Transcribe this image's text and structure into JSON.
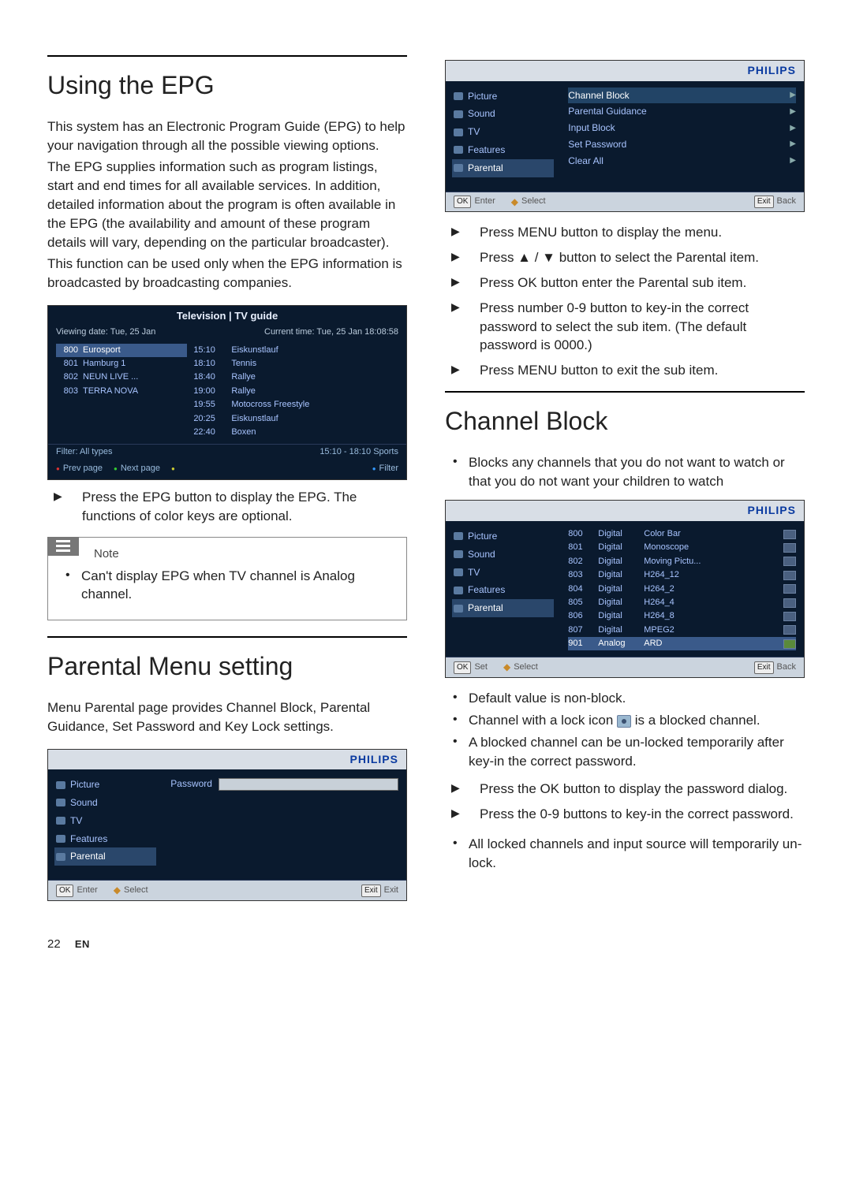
{
  "left": {
    "epg_section": {
      "title": "Using the EPG",
      "para1": "This system has an Electronic Program Guide (EPG) to help your navigation through all the possible viewing options.",
      "para2": "The EPG supplies information such as program listings, start and end times for all available services. In addition, detailed information about the program is often available in the EPG (the availability and amount of these program details will vary, depending on the particular broadcaster).",
      "para3": "This function can be used only when the EPG information is broadcasted by broadcasting companies.",
      "panel": {
        "title": "Television | TV guide",
        "viewing_date": "Viewing date: Tue, 25 Jan",
        "current_time": "Current time: Tue, 25 Jan  18:08:58",
        "channels": [
          {
            "num": "800",
            "name": "Eurosport",
            "sel": true
          },
          {
            "num": "801",
            "name": "Hamburg 1"
          },
          {
            "num": "802",
            "name": "NEUN LIVE ..."
          },
          {
            "num": "803",
            "name": "TERRA NOVA"
          }
        ],
        "times": [
          "15:10",
          "18:10",
          "18:40",
          "19:00",
          "19:55",
          "20:25",
          "22:40"
        ],
        "progs": [
          "Eiskunstlauf",
          "Tennis",
          "Rallye",
          "Rallye",
          "Motocross Freestyle",
          "Eiskunstlauf",
          "Boxen"
        ],
        "filter_left": "Filter: All types",
        "filter_right": "15:10 - 18:10  Sports",
        "footer": {
          "prev": "Prev page",
          "next": "Next page",
          "blank": "",
          "filter": "Filter"
        }
      },
      "instr": "Press the EPG button to display the EPG. The functions of color keys are optional.",
      "note_label": "Note",
      "note_text": "Can't display EPG when TV channel is Analog channel."
    },
    "parental_section": {
      "title": "Parental Menu setting",
      "para": "Menu Parental page provides Channel Block, Parental Guidance, Set Password and Key Lock settings.",
      "panel": {
        "brand": "PHILIPS",
        "side": [
          "Picture",
          "Sound",
          "TV",
          "Features",
          "Parental"
        ],
        "side_sel": 4,
        "password_label": "Password",
        "footer": {
          "ok": "OK",
          "ok_lbl": "Enter",
          "select": "Select",
          "exit": "Exit",
          "exit_lbl": "Exit"
        }
      }
    }
  },
  "right": {
    "menu_panel": {
      "brand": "PHILIPS",
      "side": [
        "Picture",
        "Sound",
        "TV",
        "Features",
        "Parental"
      ],
      "side_sel": 4,
      "items": [
        {
          "label": "Channel Block",
          "hl": true
        },
        {
          "label": "Parental Guidance"
        },
        {
          "label": "Input Block"
        },
        {
          "label": "Set Password"
        },
        {
          "label": "Clear All"
        }
      ],
      "footer": {
        "ok": "OK",
        "ok_lbl": "Enter",
        "select": "Select",
        "exit": "Exit",
        "exit_lbl": "Back"
      }
    },
    "steps": [
      "Press MENU button to display the menu.",
      "Press ▲ / ▼ button to select the Parental item.",
      "Press OK button enter the Parental sub item.",
      "Press number 0-9 button to key-in the correct password to select the sub item. (The default password is 0000.)",
      "Press MENU button to exit the sub item."
    ],
    "cb_section": {
      "title": "Channel Block",
      "intro": "Blocks any channels that you do not want to watch or that you do not want your children to watch",
      "panel": {
        "brand": "PHILIPS",
        "side": [
          "Picture",
          "Sound",
          "TV",
          "Features",
          "Parental"
        ],
        "side_sel": 4,
        "rows": [
          {
            "n": "800",
            "t": "Digital",
            "name": "Color Bar"
          },
          {
            "n": "801",
            "t": "Digital",
            "name": "Monoscope"
          },
          {
            "n": "802",
            "t": "Digital",
            "name": "Moving Pictu..."
          },
          {
            "n": "803",
            "t": "Digital",
            "name": "H264_12"
          },
          {
            "n": "804",
            "t": "Digital",
            "name": "H264_2"
          },
          {
            "n": "805",
            "t": "Digital",
            "name": "H264_4"
          },
          {
            "n": "806",
            "t": "Digital",
            "name": "H264_8"
          },
          {
            "n": "807",
            "t": "Digital",
            "name": "MPEG2"
          },
          {
            "n": "901",
            "t": "Analog",
            "name": "ARD",
            "sel": true
          }
        ],
        "footer": {
          "ok": "OK",
          "ok_lbl": "Set",
          "select": "Select",
          "exit": "Exit",
          "exit_lbl": "Back"
        }
      },
      "notes": {
        "n1": "Default value is non-block.",
        "n2a": "Channel with a lock icon ",
        "n2b": " is a blocked channel.",
        "n3": "A blocked channel can be un-locked temporarily after key-in the correct password."
      },
      "steps2": [
        "Press the OK button to display the password dialog.",
        "Press the 0-9 buttons to key-in the correct password."
      ],
      "final": "All locked channels and input source will temporarily un-lock."
    }
  },
  "footer": {
    "page": "22",
    "lang": "EN"
  }
}
